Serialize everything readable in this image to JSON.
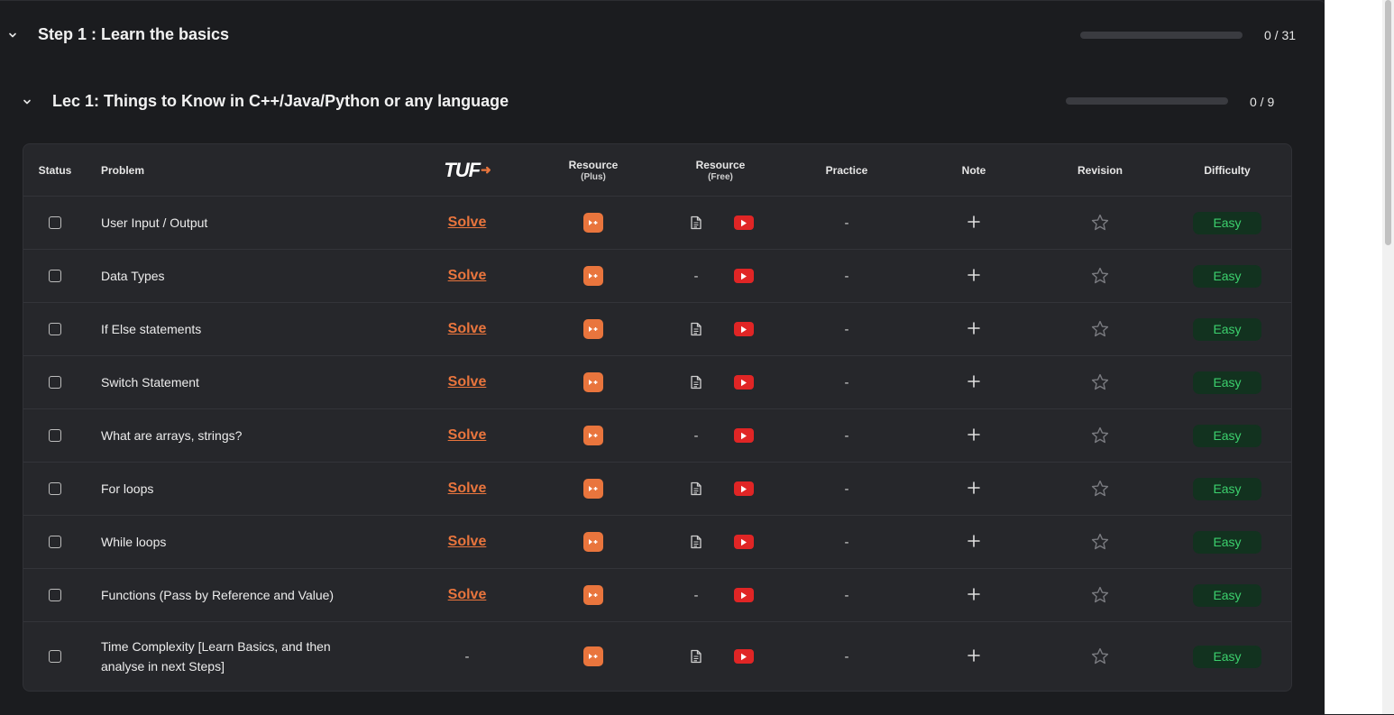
{
  "step": {
    "title": "Step 1 : Learn the basics",
    "progress_text": "0 / 31",
    "progress": 0
  },
  "lecture": {
    "title": "Lec 1: Things to Know in C++/Java/Python or any language",
    "progress_text": "0 / 9",
    "progress": 0
  },
  "headers": {
    "status": "Status",
    "problem": "Problem",
    "tuf_logo": "TUF",
    "resource_plus": "Resource",
    "resource_plus_sub": "(Plus)",
    "resource_free": "Resource",
    "resource_free_sub": "(Free)",
    "practice": "Practice",
    "note": "Note",
    "revision": "Revision",
    "difficulty": "Difficulty"
  },
  "colors": {
    "accent": "#e9753d",
    "youtube": "#e02525",
    "easy_text": "#3cd06d",
    "easy_bg": "#12321f"
  },
  "rows": [
    {
      "problem": "User Input / Output",
      "solve": "Solve",
      "article": true,
      "practice": "-",
      "difficulty": "Easy"
    },
    {
      "problem": "Data Types",
      "solve": "Solve",
      "article": false,
      "practice": "-",
      "difficulty": "Easy"
    },
    {
      "problem": "If Else statements",
      "solve": "Solve",
      "article": true,
      "practice": "-",
      "difficulty": "Easy"
    },
    {
      "problem": "Switch Statement",
      "solve": "Solve",
      "article": true,
      "practice": "-",
      "difficulty": "Easy"
    },
    {
      "problem": "What are arrays, strings?",
      "solve": "Solve",
      "article": false,
      "practice": "-",
      "difficulty": "Easy"
    },
    {
      "problem": "For loops",
      "solve": "Solve",
      "article": true,
      "practice": "-",
      "difficulty": "Easy"
    },
    {
      "problem": "While loops",
      "solve": "Solve",
      "article": true,
      "practice": "-",
      "difficulty": "Easy"
    },
    {
      "problem": "Functions (Pass by Reference and Value)",
      "solve": "Solve",
      "article": false,
      "practice": "-",
      "difficulty": "Easy"
    },
    {
      "problem": "Time Complexity [Learn Basics, and then analyse in next Steps]",
      "solve": "-",
      "article": true,
      "practice": "-",
      "difficulty": "Easy"
    }
  ],
  "placeholders": {
    "no_article": "-"
  }
}
